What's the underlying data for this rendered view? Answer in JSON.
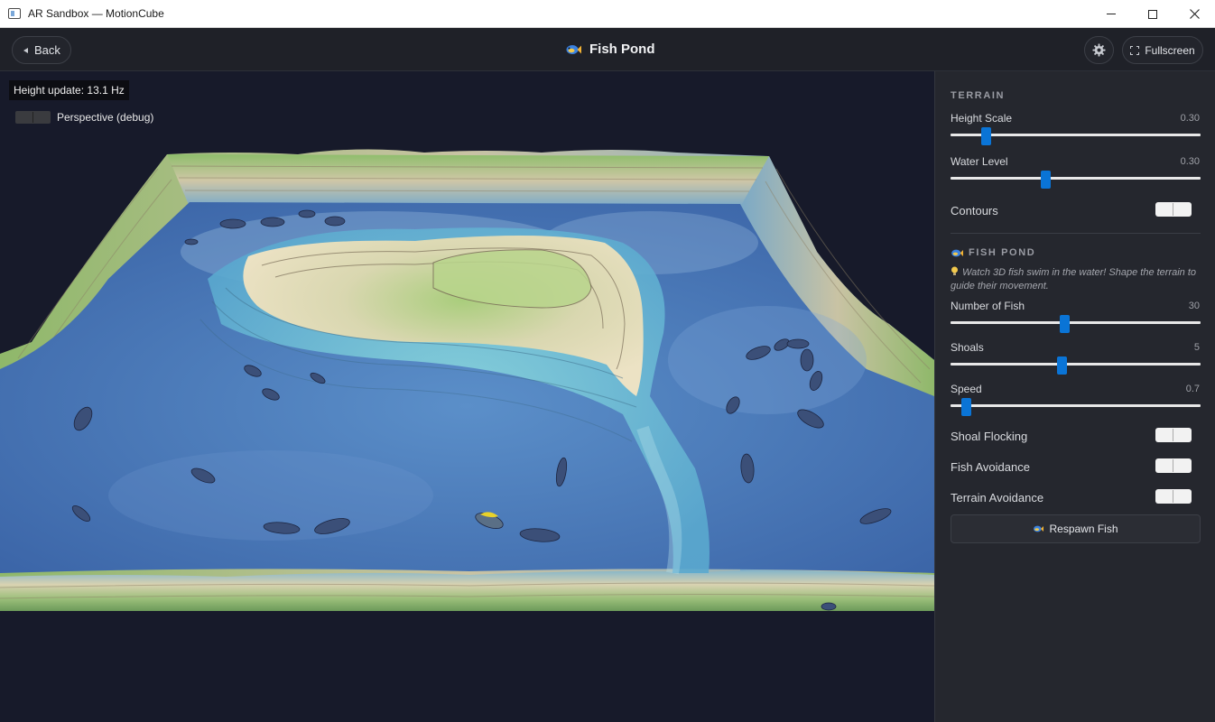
{
  "window": {
    "title": "AR Sandbox — MotionCube"
  },
  "header": {
    "back_label": "Back",
    "title": "Fish Pond",
    "fullscreen_label": "Fullscreen"
  },
  "viewport": {
    "height_update": "Height update: 13.1 Hz",
    "perspective_label": "Perspective (debug)",
    "perspective_on": false
  },
  "sidebar": {
    "terrain": {
      "heading": "TERRAIN",
      "height_scale": {
        "label": "Height Scale",
        "value": "0.30",
        "fraction": 0.14
      },
      "water_level": {
        "label": "Water Level",
        "value": "0.30",
        "fraction": 0.38
      },
      "contours": {
        "label": "Contours",
        "on": true
      }
    },
    "fish_pond": {
      "heading": "FISH POND",
      "hint_icon": "lightbulb-icon",
      "hint": "Watch 3D fish swim in the water! Shape the terrain to guide their movement.",
      "number_of_fish": {
        "label": "Number of Fish",
        "value": "30",
        "fraction": 0.455
      },
      "shoals": {
        "label": "Shoals",
        "value": "5",
        "fraction": 0.444
      },
      "speed": {
        "label": "Speed",
        "value": "0.7",
        "fraction": 0.06
      },
      "shoal_flocking": {
        "label": "Shoal Flocking",
        "on": true
      },
      "fish_avoidance": {
        "label": "Fish Avoidance",
        "on": true
      },
      "terrain_avoidance": {
        "label": "Terrain Avoidance",
        "on": true
      },
      "respawn_label": "Respawn Fish"
    }
  },
  "colors": {
    "accent": "#0a74d6",
    "water": "#3f6fb0",
    "shallow": "#6fc8d3",
    "sand": "#e8dcbc",
    "grass": "#8cbf6a",
    "background": "#171a2a"
  }
}
